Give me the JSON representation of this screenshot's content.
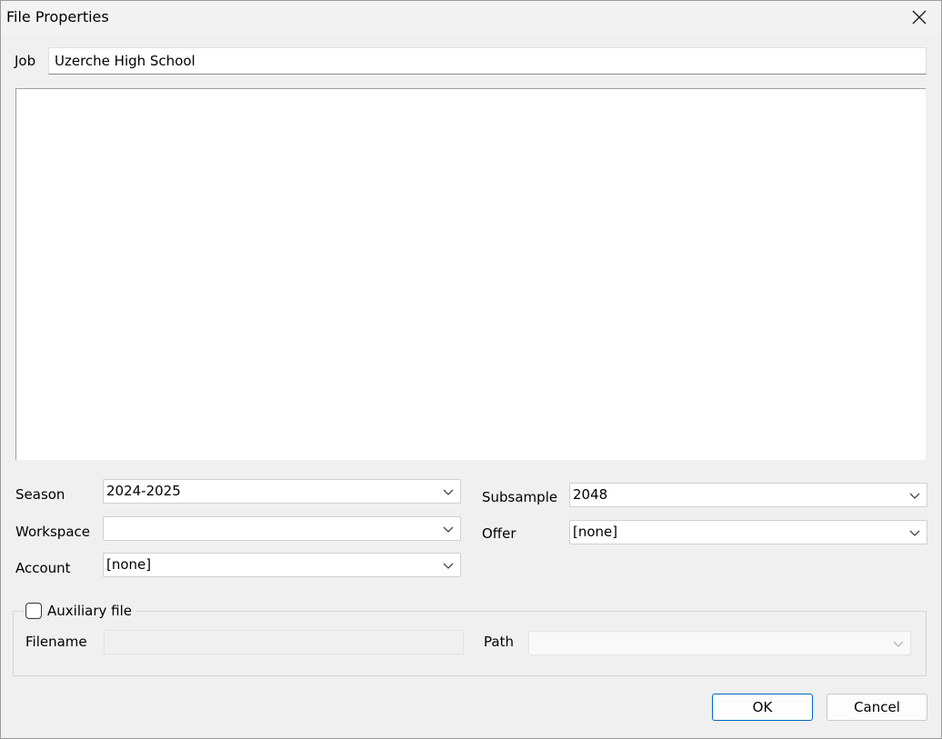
{
  "window": {
    "title": "File Properties"
  },
  "job": {
    "label": "Job",
    "value": "Uzerche High School"
  },
  "season": {
    "label": "Season",
    "value": "2024-2025"
  },
  "workspace": {
    "label": "Workspace",
    "value": ""
  },
  "account": {
    "label": "Account",
    "value": "[none]"
  },
  "subsample": {
    "label": "Subsample",
    "value": "2048"
  },
  "offer": {
    "label": "Offer",
    "value": "[none]"
  },
  "auxiliary": {
    "checkbox_label": "Auxiliary file",
    "checked": false,
    "filename_label": "Filename",
    "filename_value": "",
    "path_label": "Path",
    "path_value": ""
  },
  "buttons": {
    "ok": "OK",
    "cancel": "Cancel"
  },
  "icons": {
    "close": "close-icon",
    "dropdown": "chevron-down-icon",
    "checkbox": "checkbox-icon"
  }
}
